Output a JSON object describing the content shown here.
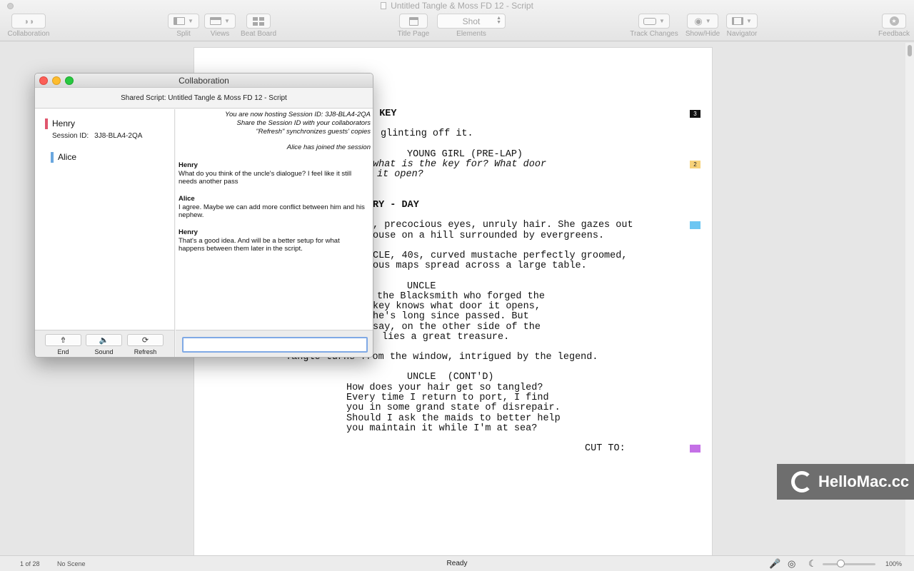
{
  "window": {
    "title": "Untitled Tangle & Moss FD 12 - Script"
  },
  "toolbar": {
    "collaboration": "Collaboration",
    "split": "Split",
    "views": "Views",
    "beat_board": "Beat Board",
    "title_page": "Title Page",
    "elements": "Elements",
    "element_value": "Shot",
    "track_changes": "Track Changes",
    "show_hide": "Show/Hide",
    "navigator": "Navigator",
    "feedback": "Feedback"
  },
  "script": {
    "lines": [
      {
        "text": "D KEY",
        "style": "bold"
      },
      {
        "text": "glinting off it.",
        "style": ""
      },
      {
        "text": "YOUNG GIRL (PRE-LAP)",
        "style": ""
      },
      {
        "text": "what is the key for? What door",
        "style": "ital"
      },
      {
        "text": "it open?",
        "style": "ital"
      },
      {
        "text": "RY - DAY",
        "style": "bold"
      },
      {
        "text": ", precocious eyes, unruly hair. She gazes out",
        "style": ""
      },
      {
        "text": "ouse on a hill surrounded by evergreens.",
        "style": ""
      },
      {
        "text": "CLE, 40s, curved mustache perfectly groomed,",
        "style": ""
      },
      {
        "text": "ous maps spread across a large table.",
        "style": ""
      },
      {
        "text": "UNCLE",
        "style": ""
      },
      {
        "text": "the Blacksmith who forged the",
        "style": ""
      },
      {
        "text": "key knows what door it opens,",
        "style": ""
      },
      {
        "text": "he's long since passed. But",
        "style": ""
      },
      {
        "text": "say, on the other side of the",
        "style": ""
      },
      {
        "text": "lies a great treasure.",
        "style": ""
      },
      {
        "text": "Tangle turns from the window, intrigued by the legend.",
        "style": ""
      },
      {
        "text": "UNCLE  (CONT'D)",
        "style": ""
      },
      {
        "text": "How does your hair get so tangled?",
        "style": ""
      },
      {
        "text": "Every time I return to port, I find",
        "style": ""
      },
      {
        "text": "you in some grand state of disrepair.",
        "style": ""
      },
      {
        "text": "Should I ask the maids to better help",
        "style": ""
      },
      {
        "text": "you maintain it while I'm at sea?",
        "style": ""
      },
      {
        "text": "CUT TO:",
        "style": ""
      }
    ],
    "markers": [
      "3",
      "2"
    ],
    "marker_colors": {
      "black": "#111111",
      "yellow": "#f7d27a",
      "blue": "#6cc6f2",
      "purple": "#c470e6"
    }
  },
  "collaboration": {
    "title": "Collaboration",
    "shared_script": "Shared Script: Untitled Tangle & Moss FD 12 - Script",
    "users": [
      {
        "name": "Henry",
        "color": "#e0566d"
      },
      {
        "name": "Alice",
        "color": "#6aa7df"
      }
    ],
    "session_label": "Session ID:",
    "session_id": "3J8-BLA4-2QA",
    "system_lines": [
      "You are now hosting Session ID: 3J8-BLA4-2QA",
      "Share the Session ID with your collaborators",
      "\"Refresh\" synchronizes guests' copies"
    ],
    "join_notice": "Alice has joined the session",
    "messages": [
      {
        "author": "Henry",
        "text": "What do you think of the uncle's dialogue? I feel like it still needs another pass"
      },
      {
        "author": "Alice",
        "text": "I agree. Maybe we can add more conflict between him and his nephew."
      },
      {
        "author": "Henry",
        "text": "That's a good idea. And will be a better setup for what happens between them later in the script."
      }
    ],
    "actions": {
      "end": "End",
      "sound": "Sound",
      "refresh": "Refresh"
    },
    "input_value": ""
  },
  "statusbar": {
    "page": "1 of 28",
    "scene": "No Scene",
    "status": "Ready",
    "zoom": "100%"
  },
  "watermark": "HelloMac.cc"
}
